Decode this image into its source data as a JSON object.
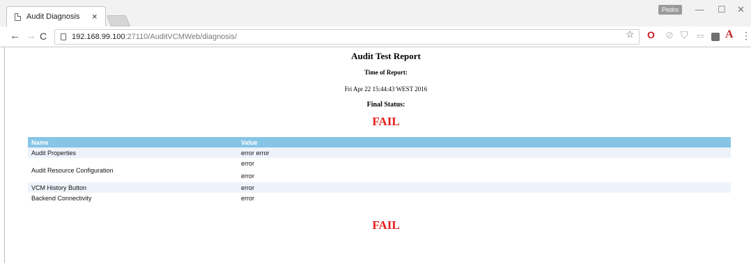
{
  "browser": {
    "tab": {
      "title": "Audit Diagnosis",
      "close_glyph": "×"
    },
    "user_badge": "Pedro",
    "window_controls": {
      "minimize": "—",
      "maximize": "☐",
      "close": "✕"
    },
    "url": {
      "host": "192.168.99.100",
      "port": ":27110",
      "path": "/AuditVCMWeb/diagnosis/"
    },
    "icons": {
      "back": "arrow-left-icon",
      "forward": "arrow-right-icon",
      "reload": "reload-icon",
      "bookmark": "star-icon",
      "opera": "opera-icon",
      "acrobat": "acrobat-icon",
      "menu": "more-vertical-icon"
    }
  },
  "page": {
    "title": "Audit Test Report",
    "time_label": "Time of Report:",
    "time_value": "Fri Apr 22 15:44:43 WEST 2016",
    "status_label": "Final Status:",
    "status_value": "FAIL",
    "status_color": "#e51c1c",
    "table": {
      "header_color": "#86c5e6",
      "columns": [
        "Name",
        "Value"
      ],
      "rows": [
        {
          "name": "Audit Properties",
          "values": [
            "error error"
          ]
        },
        {
          "name": "Audit Resource Configuration",
          "values": [
            "error",
            "error"
          ]
        },
        {
          "name": "VCM History Button",
          "values": [
            "error"
          ]
        },
        {
          "name": "Backend Connectivity",
          "values": [
            "error"
          ]
        }
      ]
    },
    "bottom_status": "FAIL"
  }
}
